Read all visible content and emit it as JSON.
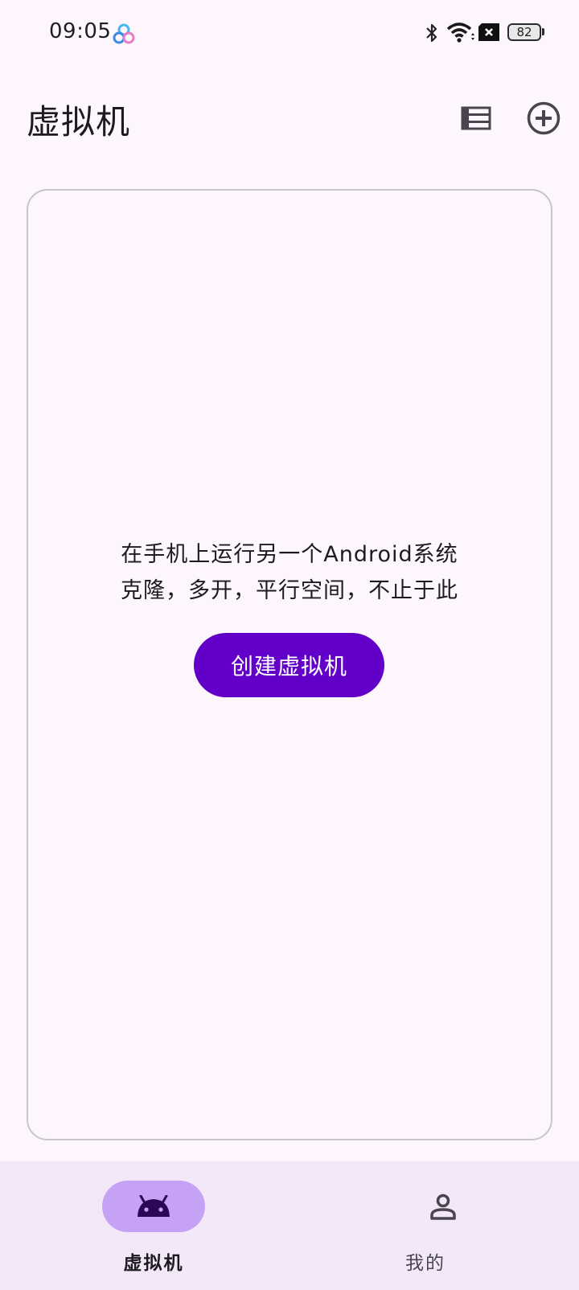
{
  "status_bar": {
    "time": "09:05",
    "battery_level": "82",
    "icons": [
      "app-notification-icon",
      "bluetooth-icon",
      "wifi-icon",
      "no-sim-icon",
      "battery-icon"
    ]
  },
  "app_bar": {
    "title": "虚拟机",
    "actions": [
      "list-view-icon",
      "add-circle-icon"
    ]
  },
  "empty_state": {
    "line1": "在手机上运行另一个Android系统",
    "line2": "克隆，多开，平行空间，不止于此",
    "button_label": "创建虚拟机"
  },
  "bottom_nav": {
    "items": [
      {
        "label": "虚拟机",
        "icon": "android-icon",
        "selected": true
      },
      {
        "label": "我的",
        "icon": "person-icon",
        "selected": false
      }
    ]
  },
  "colors": {
    "background": "#fdf7fd",
    "primary": "#6200c9",
    "nav_background": "#f3e8f8",
    "nav_indicator": "#c6a2f6",
    "card_border": "#c9c4cc"
  }
}
